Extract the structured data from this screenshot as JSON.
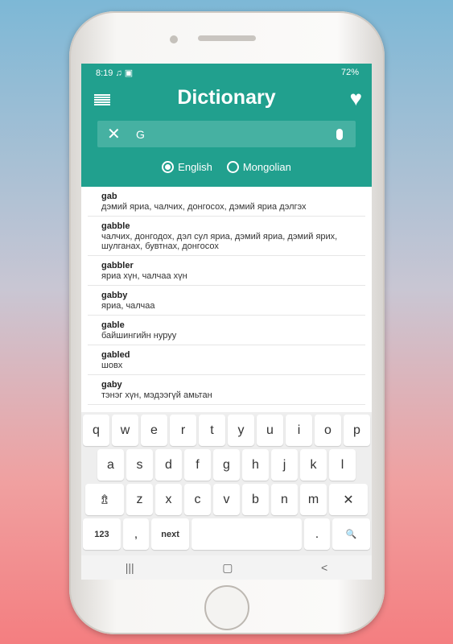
{
  "status": {
    "time": "8:19",
    "left_icons": "♫ ▣",
    "right": "72%"
  },
  "appbar": {
    "title": "Dictionary"
  },
  "search": {
    "value": "G"
  },
  "languages": [
    {
      "label": "English",
      "selected": true
    },
    {
      "label": "Mongolian",
      "selected": false
    }
  ],
  "entries": [
    {
      "word": "gab",
      "def": "дэмий яриа, чалчих, донгосох, дэмий яриа дэлгэх"
    },
    {
      "word": "gabble",
      "def": "чалчих, донгодох, дэл сул яриа, дэмий яриа, дэмий ярих, шулганах, бувтнах, донгосох"
    },
    {
      "word": "gabbler",
      "def": "яриа хүн, чалчаа хүн"
    },
    {
      "word": "gabby",
      "def": "яриа, чалчаа"
    },
    {
      "word": "gable",
      "def": "байшингийн нуруу"
    },
    {
      "word": "gabled",
      "def": "шовх"
    },
    {
      "word": "gaby",
      "def": "тэнэг хүн, мэдээгүй амьтан"
    }
  ],
  "keyboard": {
    "row1": [
      "q",
      "w",
      "e",
      "r",
      "t",
      "y",
      "u",
      "i",
      "o",
      "p"
    ],
    "row2": [
      "a",
      "s",
      "d",
      "f",
      "g",
      "h",
      "j",
      "k",
      "l"
    ],
    "row3": [
      "⇯",
      "z",
      "x",
      "c",
      "v",
      "b",
      "n",
      "m",
      "✕"
    ],
    "row4": [
      "123",
      ",",
      "next",
      " ",
      ".",
      "🔍"
    ]
  },
  "nav": [
    "|||",
    "▢",
    "<"
  ],
  "colors": {
    "primary": "#21a08e",
    "search_bg": "#46b1a2"
  }
}
